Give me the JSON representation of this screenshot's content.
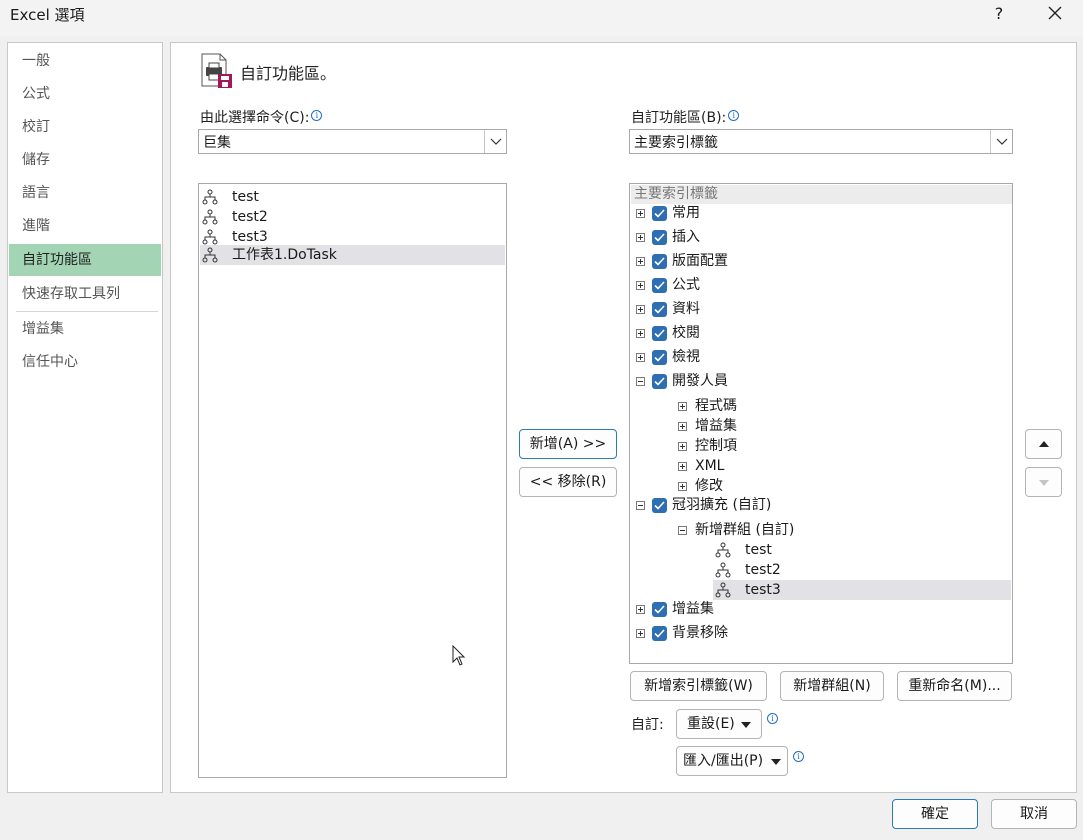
{
  "window": {
    "title": "Excel 選項",
    "help": "?"
  },
  "nav": {
    "items": [
      {
        "label": "一般"
      },
      {
        "label": "公式"
      },
      {
        "label": "校訂"
      },
      {
        "label": "儲存"
      },
      {
        "label": "語言"
      },
      {
        "label": "進階"
      },
      {
        "label": "自訂功能區"
      },
      {
        "label": "快速存取工具列"
      },
      {
        "label": "增益集"
      },
      {
        "label": "信任中心"
      }
    ],
    "selected": "自訂功能區"
  },
  "header": {
    "title": "自訂功能區。"
  },
  "left": {
    "label": "由此選擇命令(C):",
    "dropdown_value": "巨集",
    "items": [
      "test",
      "test2",
      "test3",
      "工作表1.DoTask"
    ],
    "selected_item": "工作表1.DoTask"
  },
  "middle": {
    "add_label": "新增(A) >>",
    "remove_label": "<< 移除(R)"
  },
  "right": {
    "label": "自訂功能區(B):",
    "dropdown_value": "主要索引標籤",
    "tree_header": "主要索引標籤",
    "tabs": [
      "常用",
      "插入",
      "版面配置",
      "公式",
      "資料",
      "校閱",
      "檢視",
      "開發人員"
    ],
    "dev_groups": [
      "程式碼",
      "增益集",
      "控制項",
      "XML",
      "修改"
    ],
    "custom_tab": "冠羽擴充 (自訂)",
    "custom_group": "新增群組 (自訂)",
    "custom_items": [
      "test",
      "test2",
      "test3"
    ],
    "selected_item": "test3",
    "after_tabs": [
      "增益集",
      "背景移除"
    ],
    "new_tab_label": "新增索引標籤(W)",
    "new_group_label": "新增群組(N)",
    "rename_label": "重新命名(M)...",
    "customize_label": "自訂:",
    "reset_label": "重設(E)",
    "import_export_label": "匯入/匯出(P)",
    "move_up_icon": "triangle-up-icon",
    "move_down_icon": "triangle-down-icon"
  },
  "footer": {
    "ok": "確定",
    "cancel": "取消"
  },
  "colors": {
    "nav_selected": "#a3d5b4",
    "checkbox": "#2e6fb3",
    "primary_border": "#2d7ab8"
  }
}
